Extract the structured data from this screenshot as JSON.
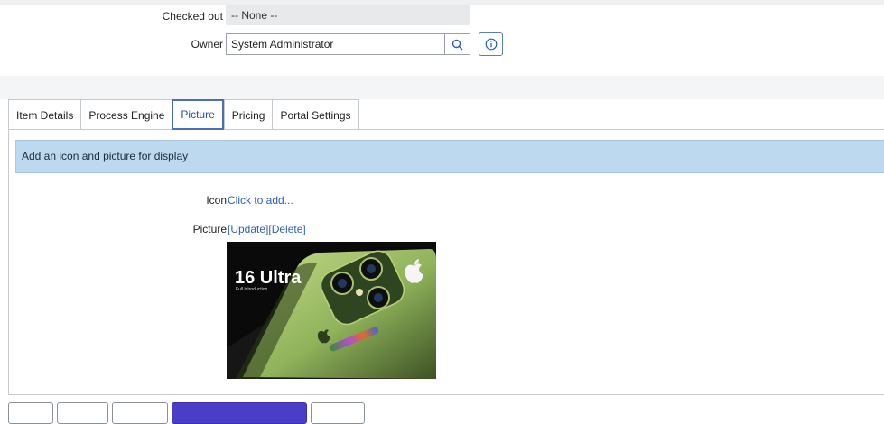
{
  "form": {
    "checked_out": {
      "label": "Checked out",
      "value": "-- None --"
    },
    "owner": {
      "label": "Owner",
      "value": "System Administrator"
    }
  },
  "tabs": [
    {
      "label": "Item Details",
      "active": false
    },
    {
      "label": "Process Engine",
      "active": false
    },
    {
      "label": "Picture",
      "active": true
    },
    {
      "label": "Pricing",
      "active": false
    },
    {
      "label": "Portal Settings",
      "active": false
    }
  ],
  "picture_tab": {
    "banner": "Add an icon and picture for display",
    "icon": {
      "label": "Icon",
      "link": "Click to add..."
    },
    "picture": {
      "label": "Picture",
      "update_link": "[Update]",
      "delete_link": "[Delete]",
      "image_text": {
        "title": "16 Ultra",
        "subtitle": "Full introduction"
      }
    }
  },
  "bottom_buttons": [
    "",
    "",
    "",
    "",
    ""
  ],
  "icons": {
    "lookup": "search-icon",
    "info": "info-icon",
    "brand": "apple-logo-icon"
  },
  "colors": {
    "accent": "#2d5fb8",
    "banner": "#bcd9ef",
    "active_tab_border": "#4a6fb8",
    "primary_button": "#4a3ec8"
  }
}
